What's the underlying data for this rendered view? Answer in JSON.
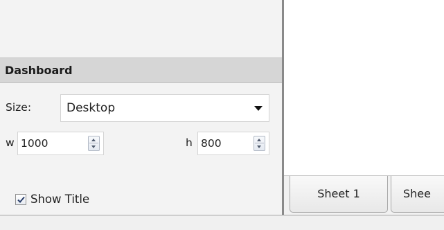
{
  "dashboard_panel": {
    "header": "Dashboard",
    "size": {
      "label": "Size:",
      "selected": "Desktop",
      "caret_icon": "chevron-down-icon"
    },
    "width": {
      "label": "w",
      "value": "1000"
    },
    "height": {
      "label": "h",
      "value": "800"
    },
    "show_title": {
      "label": "Show Title",
      "checked": true
    }
  },
  "sheet_tabs": [
    {
      "label": "Sheet 1"
    },
    {
      "label": "Shee"
    }
  ]
}
